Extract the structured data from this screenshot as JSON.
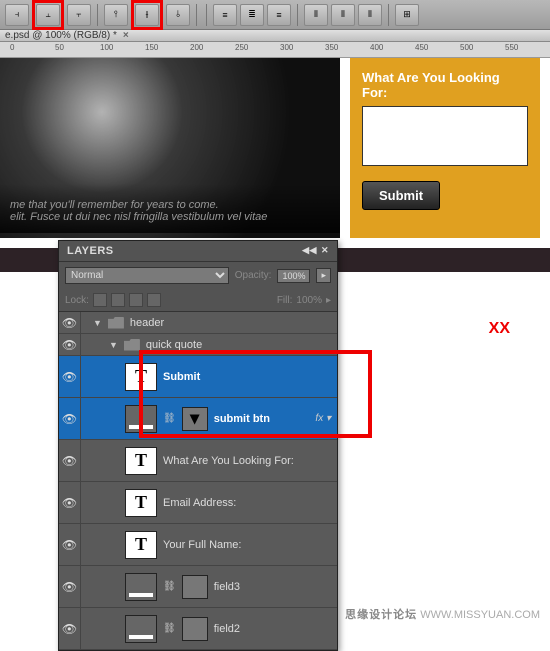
{
  "doc_tab": {
    "title": "e.psd @ 100% (RGB/8) *"
  },
  "ruler": {
    "marks": [
      "0",
      "50",
      "100",
      "150",
      "200",
      "250",
      "300",
      "350",
      "400",
      "450",
      "500",
      "550"
    ]
  },
  "hero": {
    "caption_line1": "me that you'll remember for years to come.",
    "caption_line2": "elit. Fusce ut dui nec nisl fringilla vestibulum vel vitae"
  },
  "form": {
    "label": "What Are You Looking For:",
    "submit": "Submit"
  },
  "annotation": "XX",
  "layers_panel": {
    "title": "LAYERS",
    "blend_mode": "Normal",
    "opacity_label": "Opacity:",
    "opacity_value": "100%",
    "lock_label": "Lock:",
    "fill_label": "Fill:",
    "fill_value": "100%",
    "items": [
      {
        "type": "group",
        "name": "header",
        "indent": 12
      },
      {
        "type": "group",
        "name": "quick quote",
        "indent": 28
      },
      {
        "type": "text",
        "name": "Submit",
        "indent": 44,
        "selected": true
      },
      {
        "type": "shape",
        "name": "submit btn",
        "indent": 44,
        "selected": true,
        "fx": true,
        "masked": true
      },
      {
        "type": "text",
        "name": "What Are You Looking For:",
        "indent": 44
      },
      {
        "type": "text",
        "name": "Email Address:",
        "indent": 44
      },
      {
        "type": "text",
        "name": "Your Full Name:",
        "indent": 44
      },
      {
        "type": "shape",
        "name": "field3",
        "indent": 44,
        "masked": true
      },
      {
        "type": "shape",
        "name": "field2",
        "indent": 44,
        "masked": true
      }
    ]
  },
  "watermark": {
    "cn": "思缘设计论坛",
    "url": "WWW.MISSYUAN.COM"
  }
}
